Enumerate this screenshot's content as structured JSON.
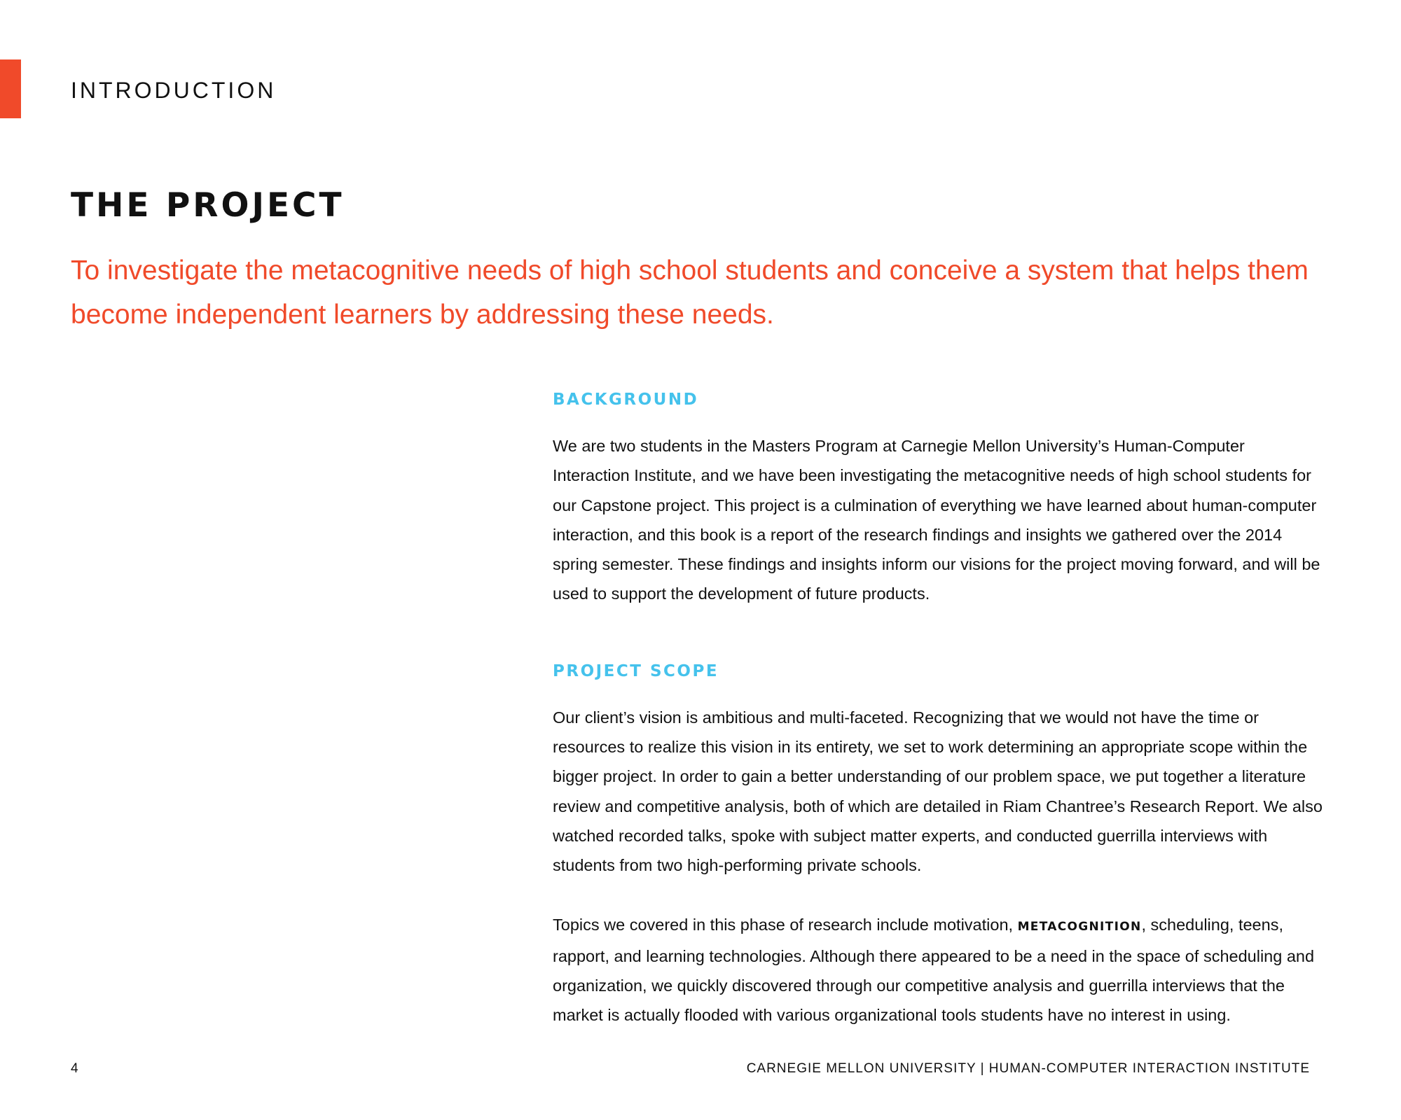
{
  "colors": {
    "accent": "#f04a2a",
    "subheading": "#45c2ec",
    "text": "#111111"
  },
  "header": {
    "section_label": "INTRODUCTION"
  },
  "title": "THE PROJECT",
  "mission": "To investigate the metacognitive needs of high school students and conceive a system that helps them become independent learners by addressing these needs.",
  "background": {
    "heading": "BACKGROUND",
    "body": "We are two students in the Masters Program at Carnegie Mellon University’s Human-Computer Interaction Institute, and we have been investigating the metacognitive needs of high school students for our Capstone project. This project is a culmination of everything we have learned about human-computer interaction, and this book is a report of the research findings and insights we gathered over the 2014 spring semester. These findings and insights inform our visions for the project moving forward, and will be used to support the development of future products."
  },
  "scope": {
    "heading": "PROJECT SCOPE",
    "body": "Our client’s vision is ambitious and multi-faceted. Recognizing that we would not have the time or resources to realize this vision in its entirety, we set to work determining an appropriate scope within the bigger project. In order to gain a better understanding of our problem space, we put together a literature review and competitive analysis, both of which are detailed in Riam Chantree’s Research Report. We also watched recorded talks, spoke with subject matter experts, and conducted guerrilla interviews with students from two high-performing private schools.",
    "topics_before": "Topics we covered in this phase of research include motivation, ",
    "topics_term": "METACOGNITION",
    "topics_after": ", scheduling, teens, rapport, and learning technologies. Although there appeared to be a need in the space of scheduling and organization, we quickly discovered through our competitive analysis and guerrilla interviews that the market is actually flooded with various organizational tools students have no interest in using."
  },
  "footer": {
    "page_number": "4",
    "credit": "CARNEGIE MELLON UNIVERSITY | HUMAN-COMPUTER INTERACTION INSTITUTE"
  }
}
